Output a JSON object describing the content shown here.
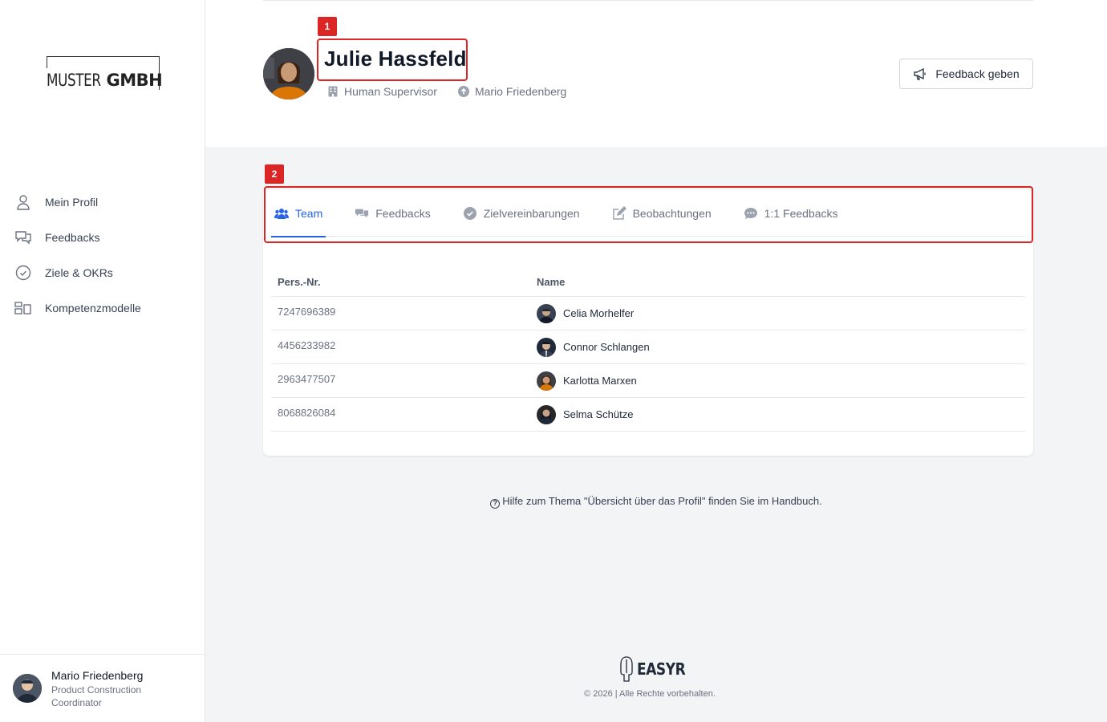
{
  "brand": {
    "logo_light": "MUSTER",
    "logo_bold": "GMBH"
  },
  "sidebar": {
    "items": [
      {
        "label": "Mein Profil",
        "icon": "user-icon"
      },
      {
        "label": "Feedbacks",
        "icon": "chat-bubbles-icon"
      },
      {
        "label": "Ziele & OKRs",
        "icon": "check-circle-icon"
      },
      {
        "label": "Kompetenzmodelle",
        "icon": "grid-icon"
      }
    ],
    "user": {
      "name": "Mario Friedenberg",
      "role": "Product Construction Coordinator"
    }
  },
  "profile": {
    "name": "Julie Hassfeld",
    "department": "Human Supervisor",
    "manager": "Mario Friedenberg",
    "feedback_button": "Feedback geben"
  },
  "annotations": {
    "name_tag": "1",
    "tabs_tag": "2"
  },
  "tabs": [
    {
      "label": "Team",
      "icon": "users-icon",
      "active": true
    },
    {
      "label": "Feedbacks",
      "icon": "comments-icon",
      "active": false
    },
    {
      "label": "Zielvereinbarungen",
      "icon": "check-circle-icon",
      "active": false
    },
    {
      "label": "Beobachtungen",
      "icon": "edit-icon",
      "active": false
    },
    {
      "label": "1:1 Feedbacks",
      "icon": "comment-dots-icon",
      "active": false
    }
  ],
  "table": {
    "headers": {
      "nr": "Pers.-Nr.",
      "name": "Name"
    },
    "rows": [
      {
        "nr": "7247696389",
        "name": "Celia Morhelfer"
      },
      {
        "nr": "4456233982",
        "name": "Connor Schlangen"
      },
      {
        "nr": "2963477507",
        "name": "Karlotta Marxen"
      },
      {
        "nr": "8068826084",
        "name": "Selma Schütze"
      }
    ]
  },
  "help": {
    "icon": "?",
    "text": "Hilfe zum Thema \"Übersicht über das Profil\" finden Sie im Handbuch."
  },
  "footer": {
    "logo": "EASYR",
    "copyright": "© 2026 | Alle Rechte vorbehalten."
  },
  "colors": {
    "accent": "#2563eb",
    "highlight": "#dc2626"
  }
}
